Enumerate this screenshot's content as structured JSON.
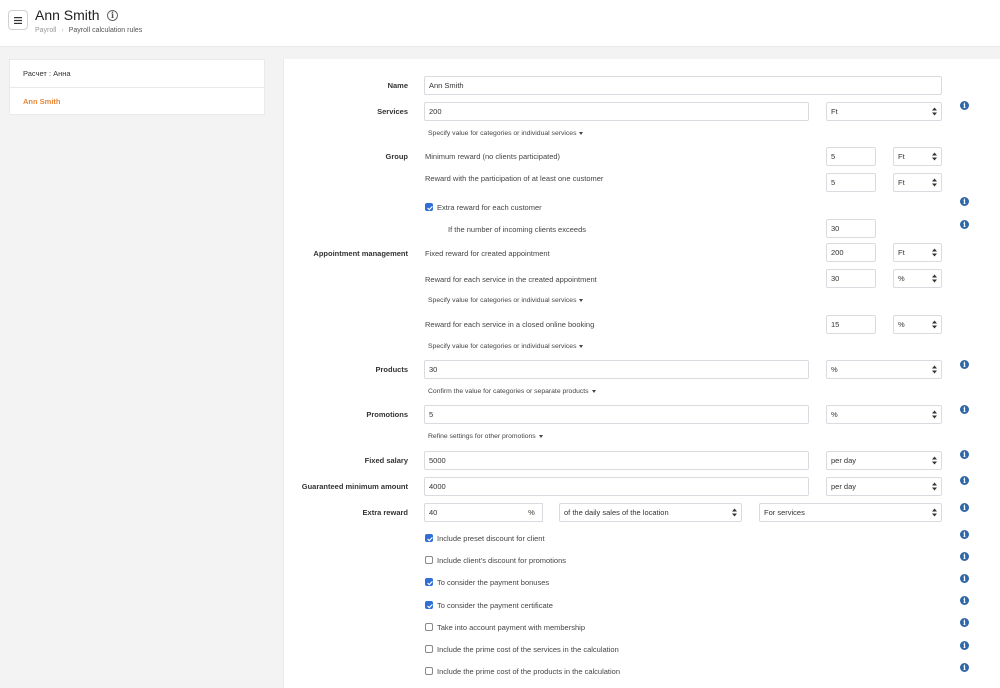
{
  "header": {
    "title": "Ann Smith",
    "breadcrumb": [
      "Payroll",
      "Payroll calculation rules"
    ]
  },
  "sidebar": {
    "items": [
      {
        "label": "Расчет : Анна",
        "active": false
      },
      {
        "label": "Ann Smith",
        "active": true
      }
    ]
  },
  "form": {
    "name_label": "Name",
    "name_value": "Ann Smith",
    "services_label": "Services",
    "services_value": "200",
    "services_unit": "Ft",
    "services_toggle": "Specify value for categories or individual services",
    "group_label": "Group",
    "group_min_reward_text": "Minimum reward (no clients participated)",
    "group_min_reward_value": "5",
    "group_min_reward_unit": "Ft",
    "group_one_customer_text": "Reward with the participation of at least one customer",
    "group_one_customer_value": "5",
    "group_one_customer_unit": "Ft",
    "extra_customer_label": "Extra reward for each customer",
    "extra_customer_checked": true,
    "incoming_clients_text": "If the number of incoming clients exceeds",
    "incoming_clients_value": "30",
    "appointment_label": "Appointment management",
    "fixed_created_text": "Fixed reward for created appointment",
    "fixed_created_value": "200",
    "fixed_created_unit": "Ft",
    "each_service_created_text": "Reward for each service in the created appointment",
    "each_service_created_value": "30",
    "each_service_created_unit": "%",
    "each_service_created_toggle": "Specify value for categories or individual services",
    "each_service_online_text": "Reward for each service in a closed online booking",
    "each_service_online_value": "15",
    "each_service_online_unit": "%",
    "each_service_online_toggle": "Specify value for categories or individual services",
    "products_label": "Products",
    "products_value": "30",
    "products_unit": "%",
    "products_toggle": "Confirm the value for categories or separate products",
    "promotions_label": "Promotions",
    "promotions_value": "5",
    "promotions_unit": "%",
    "promotions_toggle": "Refine settings for other promotions",
    "fixed_salary_label": "Fixed salary",
    "fixed_salary_value": "5000",
    "fixed_salary_period": "per day",
    "guaranteed_label": "Guaranteed minimum amount",
    "guaranteed_value": "4000",
    "guaranteed_period": "per day",
    "extra_reward_label": "Extra reward",
    "extra_reward_value": "40",
    "extra_reward_unit": "%",
    "extra_reward_base": "of the daily sales of the location",
    "extra_reward_scope": "For services"
  },
  "checkboxes": [
    {
      "label": "Include preset discount for client",
      "checked": true
    },
    {
      "label": "Include client's discount for promotions",
      "checked": false
    },
    {
      "label": "To consider the payment bonuses",
      "checked": true
    },
    {
      "label": "To consider the payment certificate",
      "checked": true
    },
    {
      "label": "Take into account payment with membership",
      "checked": false
    },
    {
      "label": "Include the prime cost of the services in the calculation",
      "checked": false
    },
    {
      "label": "Include the prime cost of the products in the calculation",
      "checked": false
    }
  ],
  "colors": {
    "accent": "#e8873a",
    "checkbox": "#2f6fd6",
    "info_icon": "#2f67a7"
  }
}
